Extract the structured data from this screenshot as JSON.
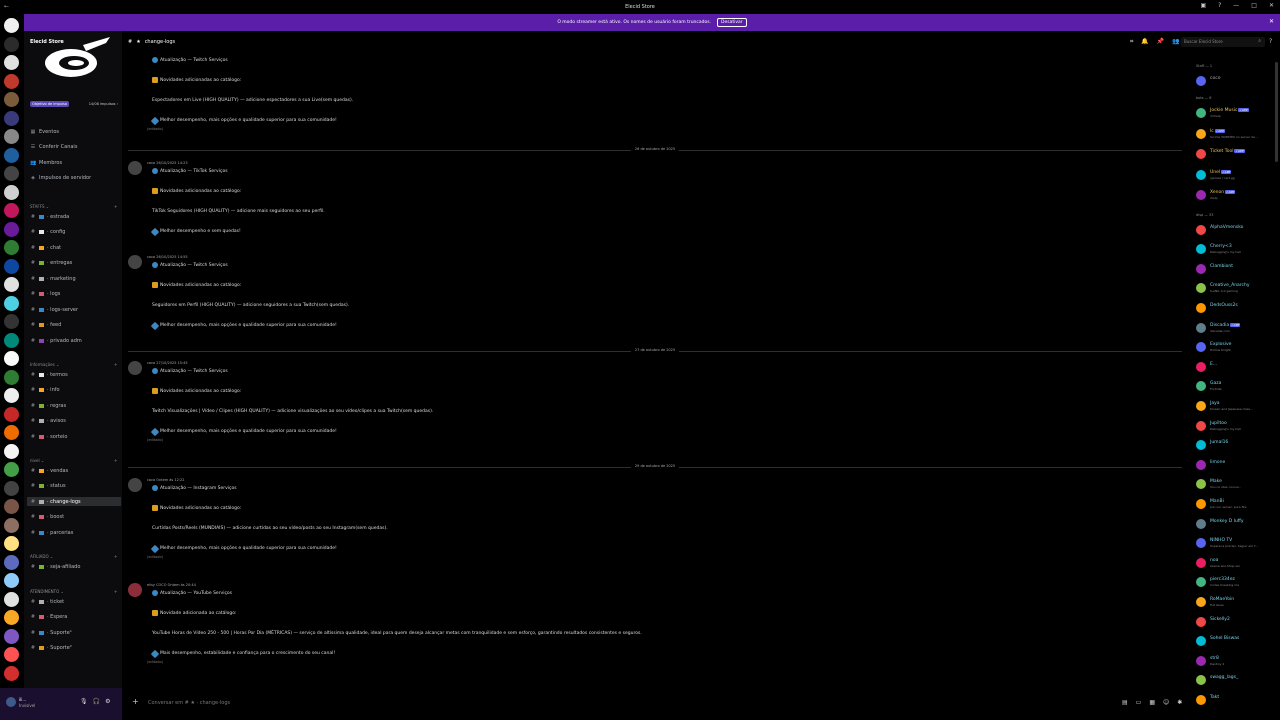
{
  "window": {
    "title": "Elecid Store"
  },
  "banner": {
    "text": "O modo streamer está ativo. Os nomes de usuário foram truncados.",
    "button": "Desativar"
  },
  "server": {
    "name": "Elecid Store",
    "boost_goal": "Objetivo de impulso",
    "boost_count": "14/08 impulsos ›"
  },
  "sidebar": {
    "top_items": [
      {
        "icon": "calendar-icon",
        "label": "Eventos"
      },
      {
        "icon": "channels-icon",
        "label": "Conferir Canais"
      },
      {
        "icon": "members-icon",
        "label": "Membros"
      },
      {
        "icon": "boost-icon",
        "label": "Impulsos de servidor"
      }
    ],
    "categories": [
      {
        "label": "STAFFS ⌄",
        "channels": [
          "estrada",
          "config",
          "chat",
          "entregas",
          "marketing",
          "logs",
          "logs-server",
          "feed",
          "privado adm"
        ]
      },
      {
        "label": "Informações ⌄",
        "channels": [
          "termos",
          "info",
          "regras",
          "avisos",
          "sorteio"
        ]
      },
      {
        "label": "nivel ⌄",
        "channels": [
          "vendas",
          "status",
          "change-logs",
          "boost",
          "parcerias"
        ]
      },
      {
        "label": "AFILIADO ⌄",
        "channels": [
          "seja-afiliado"
        ]
      },
      {
        "label": "ATENDIMENTO ⌄",
        "channels": [
          "ticket",
          "Espera",
          "Suporte¹",
          "Suporte²"
        ]
      }
    ]
  },
  "user": {
    "name": "ili...",
    "status": "Invisível"
  },
  "header": {
    "channel": "change-logs",
    "search_placeholder": "Buscar Elecid Store"
  },
  "messages": [
    {
      "author": "",
      "time": "",
      "lines": [
        "Atualização — Twitch Serviços",
        "Novidades adicionadas ao catálogo:",
        "Espectadores em Live (HIGH QUALITY) — adicione espectadores a sua Live(sem quedas).",
        "Melhor desempenho, mais opções e qualidade superior para sua comunidade!"
      ],
      "edited": "(editado)"
    },
    {
      "author": "coco",
      "time": "26/10/2025 14:23",
      "lines": [
        "Atualização — TikTok Serviços",
        "Novidades adicionadas ao catálogo:",
        "TikTok Seguidores (HIGH QUALITY) — adicione mais seguidores ao seu perfil.",
        "Melhor desempenho e sem quedas!"
      ],
      "edited": ""
    },
    {
      "author": "coco",
      "time": "26/10/2025 14:55",
      "lines": [
        "Atualização — Twitch Serviços",
        "Novidades adicionadas ao catálogo:",
        "Seguidores em Perfil (HIGH QUALITY) — adicione seguidores a sua Twitch(sem quedas).",
        "Melhor desempenho, mais opções e qualidade superior para sua comunidade!"
      ],
      "edited": ""
    },
    {
      "author": "coco",
      "time": "27/10/2025 15:45",
      "lines": [
        "Atualização — Twitch Serviços",
        "Novidades adicionadas ao catálogo:",
        "Twitch Visualizações | Vídeo / Clipes (HIGH QUALITY) — adicione visualizações ao seu vídeo/clipes a sua Twitch(sem quedas).",
        "Melhor desempenho, mais opções e qualidade superior para sua comunidade!"
      ],
      "edited": "(editado)"
    },
    {
      "author": "coco",
      "time": "Ontem às 12:22",
      "lines": [
        "Atualização — Instagram Serviços",
        "Novidades adicionadas ao catálogo:",
        "Curtidas Posts/Reels (MUNDIAIS) — adicione curtidas ao seu vídeo/posts ao seu Instagram(sem quedas).",
        "Melhor desempenho, mais opções e qualidade superior para sua comunidade!"
      ],
      "edited": "(editado)"
    },
    {
      "author": "elisy",
      "tag": "COCO",
      "time": "Ontem às 20:44",
      "lines": [
        "Atualização — YouTube Serviços",
        "Novidade adicionada ao catálogo:",
        "YouTube Horas de Vídeo 250 - 500 | Horas Por Dia (MÉTRICAS) — serviço de altíssima qualidade, ideal para quem deseja alcançar metas com tranquilidade e sem esforço, garantindo resultados consistentes e seguros.",
        "Mais desempenho, estabilidade e confiança para o crescimento do seu canal!"
      ],
      "edited": "(editado)"
    }
  ],
  "dividers": [
    "26 de outubro de 2025",
    "27 de outubro de 2025",
    "29 de outubro de 2025"
  ],
  "composer": {
    "placeholder": "Conversar em # ★ · change-logs"
  },
  "members": {
    "staff_label": "Staff — 1",
    "staff": [
      {
        "name": "coco",
        "sub": ""
      }
    ],
    "bots_label": "bots — 6",
    "bots": [
      {
        "name": "Jockie Music",
        "sub": "m!help",
        "badge": "APP"
      },
      {
        "name": "lc",
        "sub": "Scrims 30/MHDS no server de...",
        "badge": "APP"
      },
      {
        "name": "Ticket Tool",
        "sub": "",
        "badge": "APP"
      },
      {
        "name": "Unel",
        "sub": "/games / cart.gg",
        "badge": "APP"
      },
      {
        "name": "Xenon",
        "sub": "/help",
        "badge": "APP"
      }
    ],
    "online_label": "disp — 33",
    "online": [
      {
        "name": "AlphaVmensko",
        "sub": ""
      },
      {
        "name": "Cherry<3",
        "sub": "Debugging's my hell"
      },
      {
        "name": "Clambiont",
        "sub": ""
      },
      {
        "name": "Creative_Anarchy",
        "sub": "S-ANIL 4.0 gaming"
      },
      {
        "name": "DedsOuss2s",
        "sub": ""
      },
      {
        "name": "Discadia",
        "sub": "discadia.com",
        "badge": "APP"
      },
      {
        "name": "Explosive",
        "sub": "Hollow Knight"
      },
      {
        "name": "E...",
        "sub": ""
      },
      {
        "name": "Gaza",
        "sub": "Fortnite"
      },
      {
        "name": "Jaya",
        "sub": "Korean and Japanese class..."
      },
      {
        "name": "Jupiltoo",
        "sub": "Debugging's my hell"
      },
      {
        "name": "Jumal16",
        "sub": ""
      },
      {
        "name": "limone",
        "sub": ""
      },
      {
        "name": "Make",
        "sub": "Vou no stax, lovoui..."
      },
      {
        "name": "ManBi",
        "sub": "Join our server, pura fire"
      },
      {
        "name": "Monkey D luffy",
        "sub": ""
      },
      {
        "name": "NINHO TV",
        "sub": "Superei a preciso. Seguir em f..."
      },
      {
        "name": "noa",
        "sub": "Assine aos Shop sei"
      },
      {
        "name": "pierc334ez",
        "sub": "Codes breaking me"
      },
      {
        "name": "RoMaeYoin",
        "sub": "Full Gues"
      },
      {
        "name": "Sickelly2",
        "sub": ""
      },
      {
        "name": "Sohel Biswas",
        "sub": ""
      },
      {
        "name": "str8",
        "sub": "Destiny 2"
      },
      {
        "name": "swagg_lags_",
        "sub": ""
      },
      {
        "name": "Takt",
        "sub": ""
      }
    ]
  },
  "colors": {
    "accent": "#5b1ea8",
    "member_name": "#7dd3e8",
    "bot_name": "#e8c45b"
  }
}
